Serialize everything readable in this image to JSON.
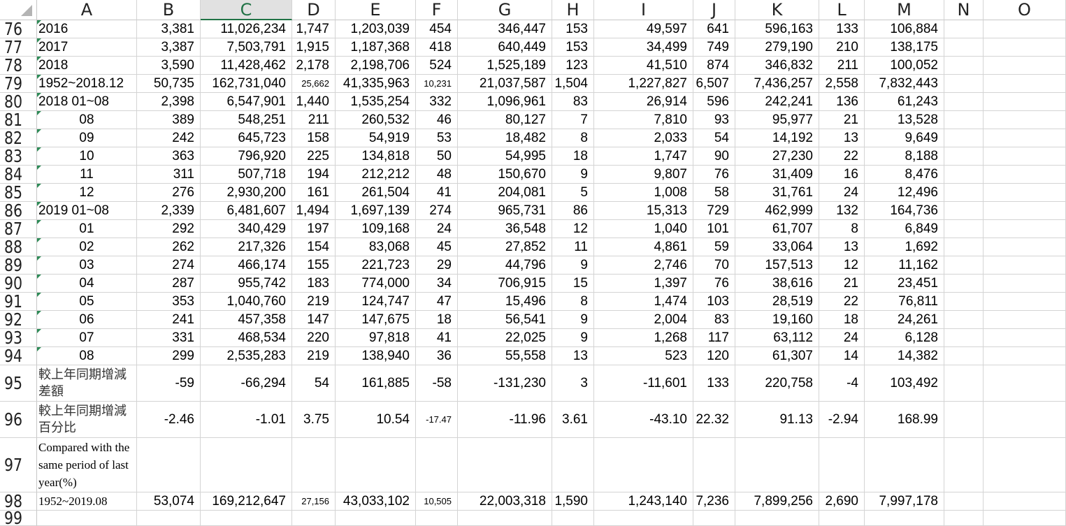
{
  "sheet": {
    "active_column": "C",
    "columns": [
      "A",
      "B",
      "C",
      "D",
      "E",
      "F",
      "G",
      "H",
      "I",
      "J",
      "K",
      "L",
      "M",
      "N",
      "O"
    ],
    "rows": [
      {
        "num": "76",
        "cells": [
          "2016",
          "3,381",
          "11,026,234",
          "1,747",
          "1,203,039",
          "454",
          "346,447",
          "153",
          "49,597",
          "641",
          "596,163",
          "133",
          "106,884",
          "",
          ""
        ]
      },
      {
        "num": "77",
        "cells": [
          "2017",
          "3,387",
          "7,503,791",
          "1,915",
          "1,187,368",
          "418",
          "640,449",
          "153",
          "34,499",
          "749",
          "279,190",
          "210",
          "138,175",
          "",
          ""
        ]
      },
      {
        "num": "78",
        "cells": [
          "2018",
          "3,590",
          "11,428,462",
          "2,178",
          "2,198,706",
          "524",
          "1,525,189",
          "123",
          "41,510",
          "874",
          "346,832",
          "211",
          "100,052",
          "",
          ""
        ]
      },
      {
        "num": "79",
        "cells": [
          "1952~2018.12",
          "50,735",
          "162,731,040",
          "25,662",
          "41,335,963",
          "10,231",
          "21,037,587",
          "1,504",
          "1,227,827",
          "6,507",
          "7,436,257",
          "2,558",
          "7,832,443",
          "",
          ""
        ]
      },
      {
        "num": "80",
        "cells": [
          "2018 01~08",
          "2,398",
          "6,547,901",
          "1,440",
          "1,535,254",
          "332",
          "1,096,961",
          "83",
          "26,914",
          "596",
          "242,241",
          "136",
          "61,243",
          "",
          ""
        ]
      },
      {
        "num": "81",
        "cells": [
          "08",
          "389",
          "548,251",
          "211",
          "260,532",
          "46",
          "80,127",
          "7",
          "7,810",
          "93",
          "95,977",
          "21",
          "13,528",
          "",
          ""
        ]
      },
      {
        "num": "82",
        "cells": [
          "09",
          "242",
          "645,723",
          "158",
          "54,919",
          "53",
          "18,482",
          "8",
          "2,033",
          "54",
          "14,192",
          "13",
          "9,649",
          "",
          ""
        ]
      },
      {
        "num": "83",
        "cells": [
          "10",
          "363",
          "796,920",
          "225",
          "134,818",
          "50",
          "54,995",
          "18",
          "1,747",
          "90",
          "27,230",
          "22",
          "8,188",
          "",
          ""
        ]
      },
      {
        "num": "84",
        "cells": [
          "11",
          "311",
          "507,718",
          "194",
          "212,212",
          "48",
          "150,670",
          "9",
          "9,807",
          "76",
          "31,409",
          "16",
          "8,476",
          "",
          ""
        ]
      },
      {
        "num": "85",
        "cells": [
          "12",
          "276",
          "2,930,200",
          "161",
          "261,504",
          "41",
          "204,081",
          "5",
          "1,008",
          "58",
          "31,761",
          "24",
          "12,496",
          "",
          ""
        ]
      },
      {
        "num": "86",
        "cells": [
          "2019 01~08",
          "2,339",
          "6,481,607",
          "1,494",
          "1,697,139",
          "274",
          "965,731",
          "86",
          "15,313",
          "729",
          "462,999",
          "132",
          "164,736",
          "",
          ""
        ]
      },
      {
        "num": "87",
        "cells": [
          "01",
          "292",
          "340,429",
          "197",
          "109,168",
          "24",
          "36,548",
          "12",
          "1,040",
          "101",
          "61,707",
          "8",
          "6,849",
          "",
          ""
        ]
      },
      {
        "num": "88",
        "cells": [
          "02",
          "262",
          "217,326",
          "154",
          "83,068",
          "45",
          "27,852",
          "11",
          "4,861",
          "59",
          "33,064",
          "13",
          "1,692",
          "",
          ""
        ]
      },
      {
        "num": "89",
        "cells": [
          "03",
          "274",
          "466,174",
          "155",
          "221,723",
          "29",
          "44,796",
          "9",
          "2,746",
          "70",
          "157,513",
          "12",
          "11,162",
          "",
          ""
        ]
      },
      {
        "num": "90",
        "cells": [
          "04",
          "287",
          "955,742",
          "183",
          "774,000",
          "34",
          "706,915",
          "15",
          "1,397",
          "76",
          "38,616",
          "21",
          "23,451",
          "",
          ""
        ]
      },
      {
        "num": "91",
        "cells": [
          "05",
          "353",
          "1,040,760",
          "219",
          "124,747",
          "47",
          "15,496",
          "8",
          "1,474",
          "103",
          "28,519",
          "22",
          "76,811",
          "",
          ""
        ]
      },
      {
        "num": "92",
        "cells": [
          "06",
          "241",
          "457,358",
          "147",
          "147,675",
          "18",
          "56,541",
          "9",
          "2,004",
          "83",
          "19,160",
          "18",
          "24,261",
          "",
          ""
        ]
      },
      {
        "num": "93",
        "cells": [
          "07",
          "331",
          "468,534",
          "220",
          "97,818",
          "41",
          "22,025",
          "9",
          "1,268",
          "117",
          "63,112",
          "24",
          "6,128",
          "",
          ""
        ]
      },
      {
        "num": "94",
        "cells": [
          "08",
          "299",
          "2,535,283",
          "219",
          "138,940",
          "36",
          "55,558",
          "13",
          "523",
          "120",
          "61,307",
          "14",
          "14,382",
          "",
          ""
        ]
      },
      {
        "num": "95",
        "cells": [
          "較上年同期增減差額",
          "-59",
          "-66,294",
          "54",
          "161,885",
          "-58",
          "-131,230",
          "3",
          "-11,601",
          "133",
          "220,758",
          "-4",
          "103,492",
          "",
          ""
        ]
      },
      {
        "num": "96",
        "cells": [
          "較上年同期增減百分比",
          "-2.46",
          "-1.01",
          "3.75",
          "10.54",
          "-17.47",
          "-11.96",
          "3.61",
          "-43.10",
          "22.32",
          "91.13",
          "-2.94",
          "168.99",
          "",
          ""
        ]
      },
      {
        "num": "97",
        "cells": [
          "Compared with the same period of last year(%)",
          "",
          "",
          "",
          "",
          "",
          "",
          "",
          "",
          "",
          "",
          "",
          "",
          "",
          ""
        ]
      },
      {
        "num": "98",
        "cells": [
          "1952~2019.08",
          "53,074",
          "169,212,647",
          "27,156",
          "43,033,102",
          "10,505",
          "22,003,318",
          "1,590",
          "1,243,140",
          "7,236",
          "7,899,256",
          "2,690",
          "7,997,178",
          "",
          ""
        ]
      },
      {
        "num": "99",
        "cells": [
          "",
          "",
          "",
          "",
          "",
          "",
          "",
          "",
          "",
          "",
          "",
          "",
          "",
          "",
          ""
        ]
      }
    ]
  }
}
